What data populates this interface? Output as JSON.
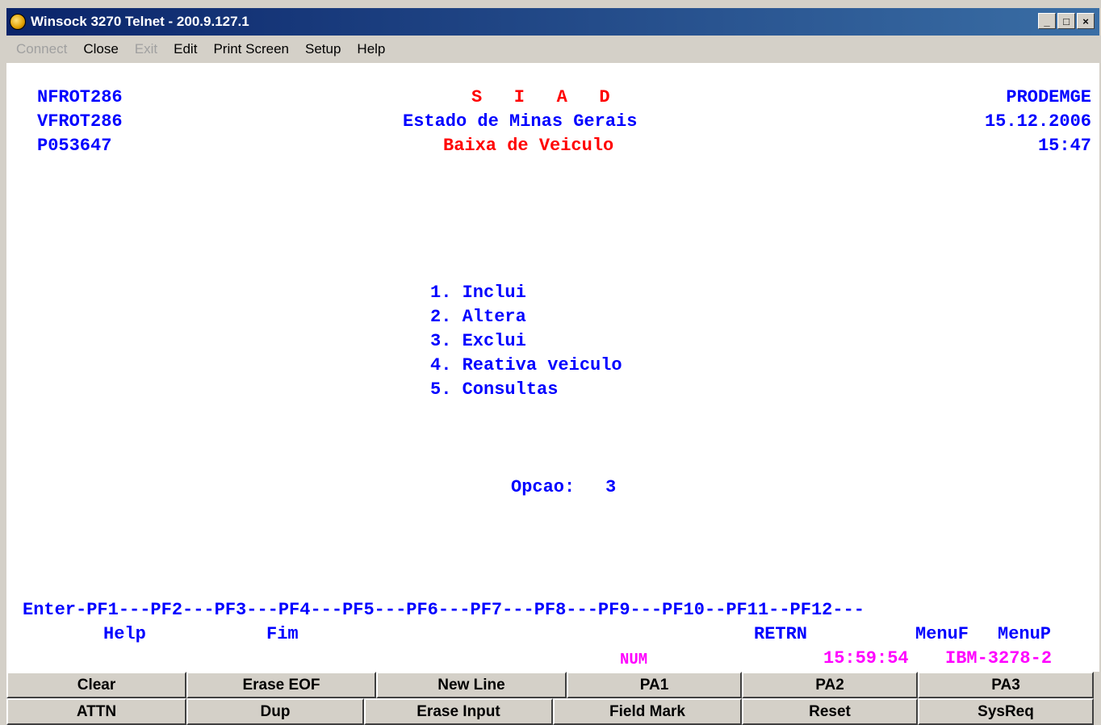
{
  "window": {
    "title": "Winsock 3270 Telnet - 200.9.127.1",
    "minimize": "_",
    "maximize": "□",
    "close": "×"
  },
  "menu": [
    {
      "label": "Connect",
      "enabled": false
    },
    {
      "label": "Close",
      "enabled": true
    },
    {
      "label": "Exit",
      "enabled": false
    },
    {
      "label": "Edit",
      "enabled": true
    },
    {
      "label": "Print Screen",
      "enabled": true
    },
    {
      "label": "Setup",
      "enabled": true
    },
    {
      "label": "Help",
      "enabled": true
    }
  ],
  "screen": {
    "header": {
      "left1": "NFROT286",
      "left2": "VFROT286",
      "left3": "P053647",
      "system": "S   I   A   D",
      "state": "Estado de Minas Gerais",
      "title": "Baixa de Veiculo",
      "org": "PRODEMGE",
      "date": "15.12.2006",
      "time": "15:47"
    },
    "options": [
      "1. Inclui",
      "2. Altera",
      "3. Exclui",
      "4. Reativa veiculo",
      "5. Consultas"
    ],
    "prompt_label": "Opcao:",
    "prompt_value": "3",
    "pf_line": "Enter-PF1---PF2---PF3---PF4---PF5---PF6---PF7---PF8---PF9---PF10--PF11--PF12---",
    "pf_help": "Help",
    "pf_fim": "Fim",
    "pf_retrn": "RETRN",
    "pf_menuf": "MenuF",
    "pf_menup": "MenuP",
    "status_num": "NUM",
    "status_clock": "15:59:54",
    "status_terminal": "IBM-3278-2"
  },
  "keypad": {
    "row1": [
      "Clear",
      "Erase EOF",
      "New Line",
      "PA1",
      "PA2",
      "PA3"
    ],
    "row2": [
      "ATTN",
      "Dup",
      "Erase Input",
      "Field Mark",
      "Reset",
      "SysReq"
    ]
  },
  "colors": {
    "field_blue": "#0000ff",
    "field_red": "#ff0000",
    "status_magenta": "#ff00ff",
    "titlebar": "#0a246a"
  }
}
